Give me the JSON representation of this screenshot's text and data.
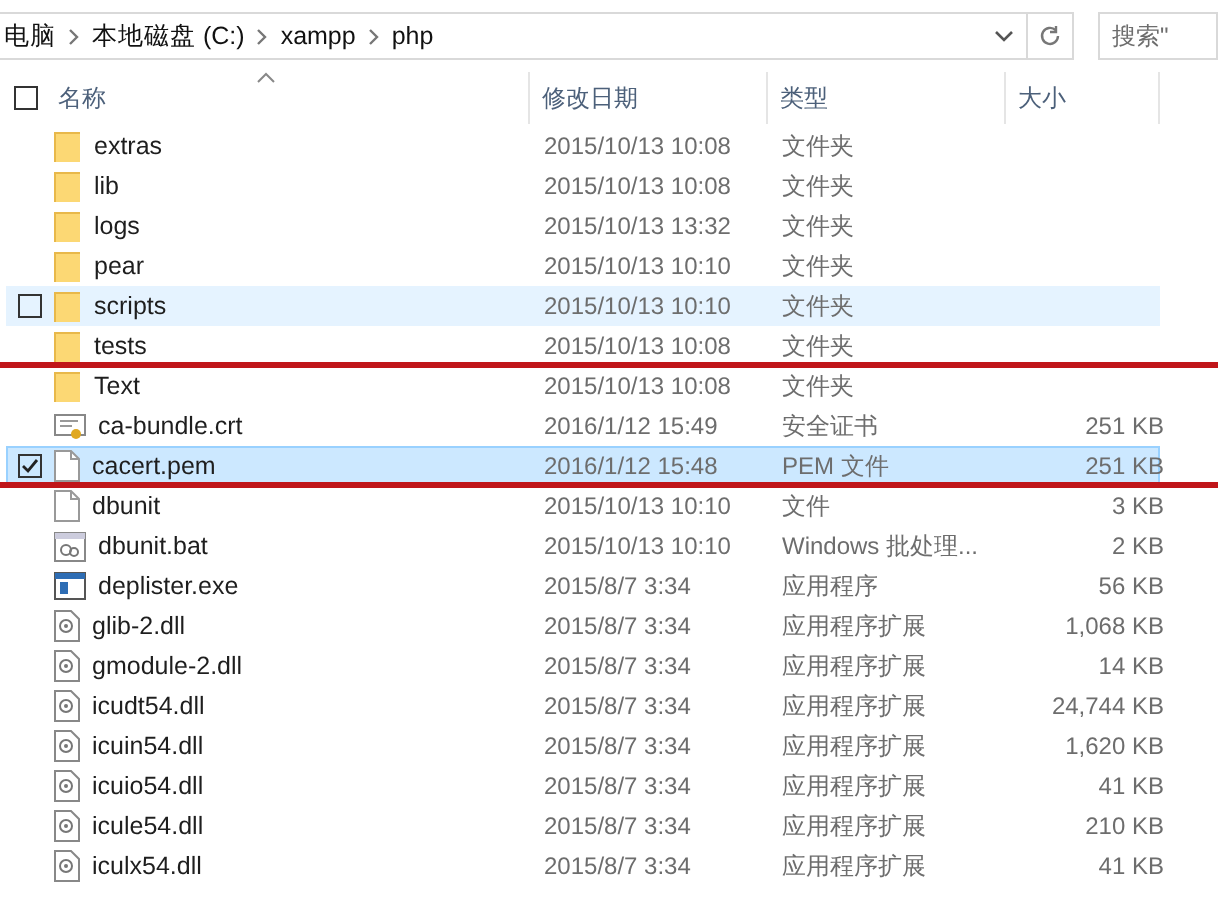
{
  "address_bar": {
    "crumbs": [
      "电脑",
      "本地磁盘 (C:)",
      "xampp",
      "php"
    ]
  },
  "search": {
    "placeholder": "搜索\""
  },
  "table": {
    "select_all_checked": false,
    "columns": [
      "名称",
      "修改日期",
      "类型",
      "大小"
    ],
    "rows": [
      {
        "kind": "folder",
        "name": "extras",
        "date": "2015/10/13 10:08",
        "type": "文件夹",
        "hovered": false,
        "selected": false
      },
      {
        "kind": "folder",
        "name": "lib",
        "date": "2015/10/13 10:08",
        "type": "文件夹",
        "hovered": false,
        "selected": false
      },
      {
        "kind": "folder",
        "name": "logs",
        "date": "2015/10/13 13:32",
        "type": "文件夹",
        "hovered": false,
        "selected": false
      },
      {
        "kind": "folder",
        "name": "pear",
        "date": "2015/10/13 10:10",
        "type": "文件夹",
        "hovered": false,
        "selected": false
      },
      {
        "kind": "folder",
        "name": "scripts",
        "date": "2015/10/13 10:10",
        "type": "文件夹",
        "hovered": true,
        "selected": false
      },
      {
        "kind": "folder",
        "name": "tests",
        "date": "2015/10/13 10:08",
        "type": "文件夹",
        "hovered": false,
        "selected": false
      },
      {
        "kind": "red_line"
      },
      {
        "kind": "folder",
        "name": "Text",
        "date": "2015/10/13 10:08",
        "type": "文件夹",
        "hovered": false,
        "selected": false
      },
      {
        "kind": "cert",
        "name": "ca-bundle.crt",
        "date": "2016/1/12 15:49",
        "type": "安全证书",
        "size": "251 KB",
        "hovered": false,
        "selected": false
      },
      {
        "kind": "file",
        "name": "cacert.pem",
        "date": "2016/1/12 15:48",
        "type": "PEM 文件",
        "size": "251 KB",
        "hovered": false,
        "selected": true
      },
      {
        "kind": "red_line"
      },
      {
        "kind": "file",
        "name": "dbunit",
        "date": "2015/10/13 10:10",
        "type": "文件",
        "size": "3 KB",
        "hovered": false,
        "selected": false
      },
      {
        "kind": "bat",
        "name": "dbunit.bat",
        "date": "2015/10/13 10:10",
        "type": "Windows 批处理...",
        "size": "2 KB",
        "hovered": false,
        "selected": false
      },
      {
        "kind": "exe",
        "name": "deplister.exe",
        "date": "2015/8/7 3:34",
        "type": "应用程序",
        "size": "56 KB",
        "hovered": false,
        "selected": false
      },
      {
        "kind": "dll",
        "name": "glib-2.dll",
        "date": "2015/8/7 3:34",
        "type": "应用程序扩展",
        "size": "1,068 KB",
        "hovered": false,
        "selected": false
      },
      {
        "kind": "dll",
        "name": "gmodule-2.dll",
        "date": "2015/8/7 3:34",
        "type": "应用程序扩展",
        "size": "14 KB",
        "hovered": false,
        "selected": false
      },
      {
        "kind": "dll",
        "name": "icudt54.dll",
        "date": "2015/8/7 3:34",
        "type": "应用程序扩展",
        "size": "24,744 KB",
        "hovered": false,
        "selected": false
      },
      {
        "kind": "dll",
        "name": "icuin54.dll",
        "date": "2015/8/7 3:34",
        "type": "应用程序扩展",
        "size": "1,620 KB",
        "hovered": false,
        "selected": false
      },
      {
        "kind": "dll",
        "name": "icuio54.dll",
        "date": "2015/8/7 3:34",
        "type": "应用程序扩展",
        "size": "41 KB",
        "hovered": false,
        "selected": false
      },
      {
        "kind": "dll",
        "name": "icule54.dll",
        "date": "2015/8/7 3:34",
        "type": "应用程序扩展",
        "size": "210 KB",
        "hovered": false,
        "selected": false
      },
      {
        "kind": "dll",
        "name": "iculx54.dll",
        "date": "2015/8/7 3:34",
        "type": "应用程序扩展",
        "size": "41 KB",
        "hovered": false,
        "selected": false
      }
    ]
  }
}
